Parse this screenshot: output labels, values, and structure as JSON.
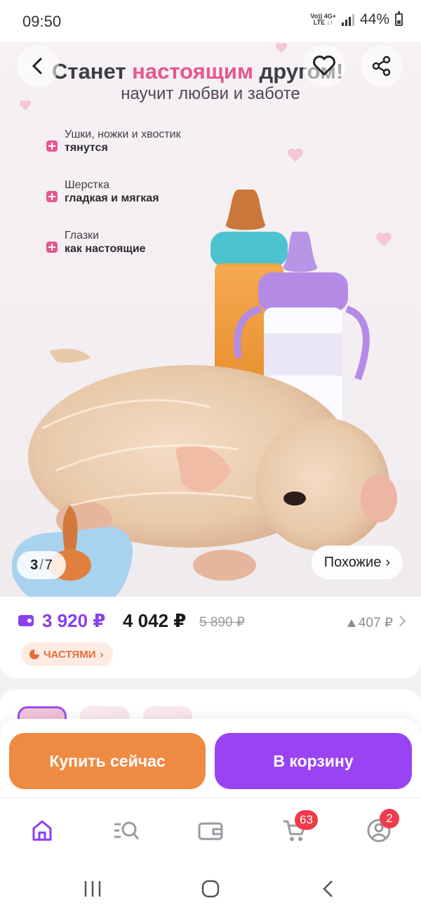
{
  "status_bar": {
    "time": "09:50",
    "network_top": "Vo)) 4G+",
    "network_bottom": "LTE ↓↑",
    "battery_percent": "44%"
  },
  "banner": {
    "title_before": "Станет ",
    "title_accent": "настоящим",
    "title_after": " другом!",
    "subtitle": "научит любви и заботе",
    "accent_color": "#e8568f",
    "features": [
      {
        "label": "Ушки, ножки и хвостик",
        "value": "тянутся"
      },
      {
        "label": "Шерстка",
        "value": "гладкая и мягкая"
      },
      {
        "label": "Глазки",
        "value": "как настоящие"
      }
    ]
  },
  "gallery": {
    "current": "3",
    "total": "7",
    "separator": "/",
    "similar_label": "Похожие",
    "similar_chevron": "›"
  },
  "icons": {
    "back": "back-arrow-icon",
    "favorite": "heart-icon",
    "share": "share-icon"
  },
  "price": {
    "wallet_price": "3 920 ₽",
    "price": "4 042 ₽",
    "old_price": "5 890 ₽",
    "diff": "407 ₽",
    "wallet_color": "#8a3ff2",
    "installments_label": "ЧАСТЯМИ",
    "installments_chevron": "›"
  },
  "actions": {
    "buy_now": "Купить сейчас",
    "add_to_cart": "В корзину",
    "buy_color": "#ef8a43",
    "cart_color": "#9a43f2"
  },
  "bottom_nav": {
    "items": [
      {
        "icon": "home-icon",
        "active": true
      },
      {
        "icon": "catalog-search-icon"
      },
      {
        "icon": "wallet-icon"
      },
      {
        "icon": "cart-icon",
        "badge": "63"
      },
      {
        "icon": "profile-icon",
        "badge": "2"
      }
    ],
    "active_color": "#8a3ff2"
  },
  "system_nav": {
    "items": [
      "recents-icon",
      "home-circle-icon",
      "back-icon"
    ]
  }
}
